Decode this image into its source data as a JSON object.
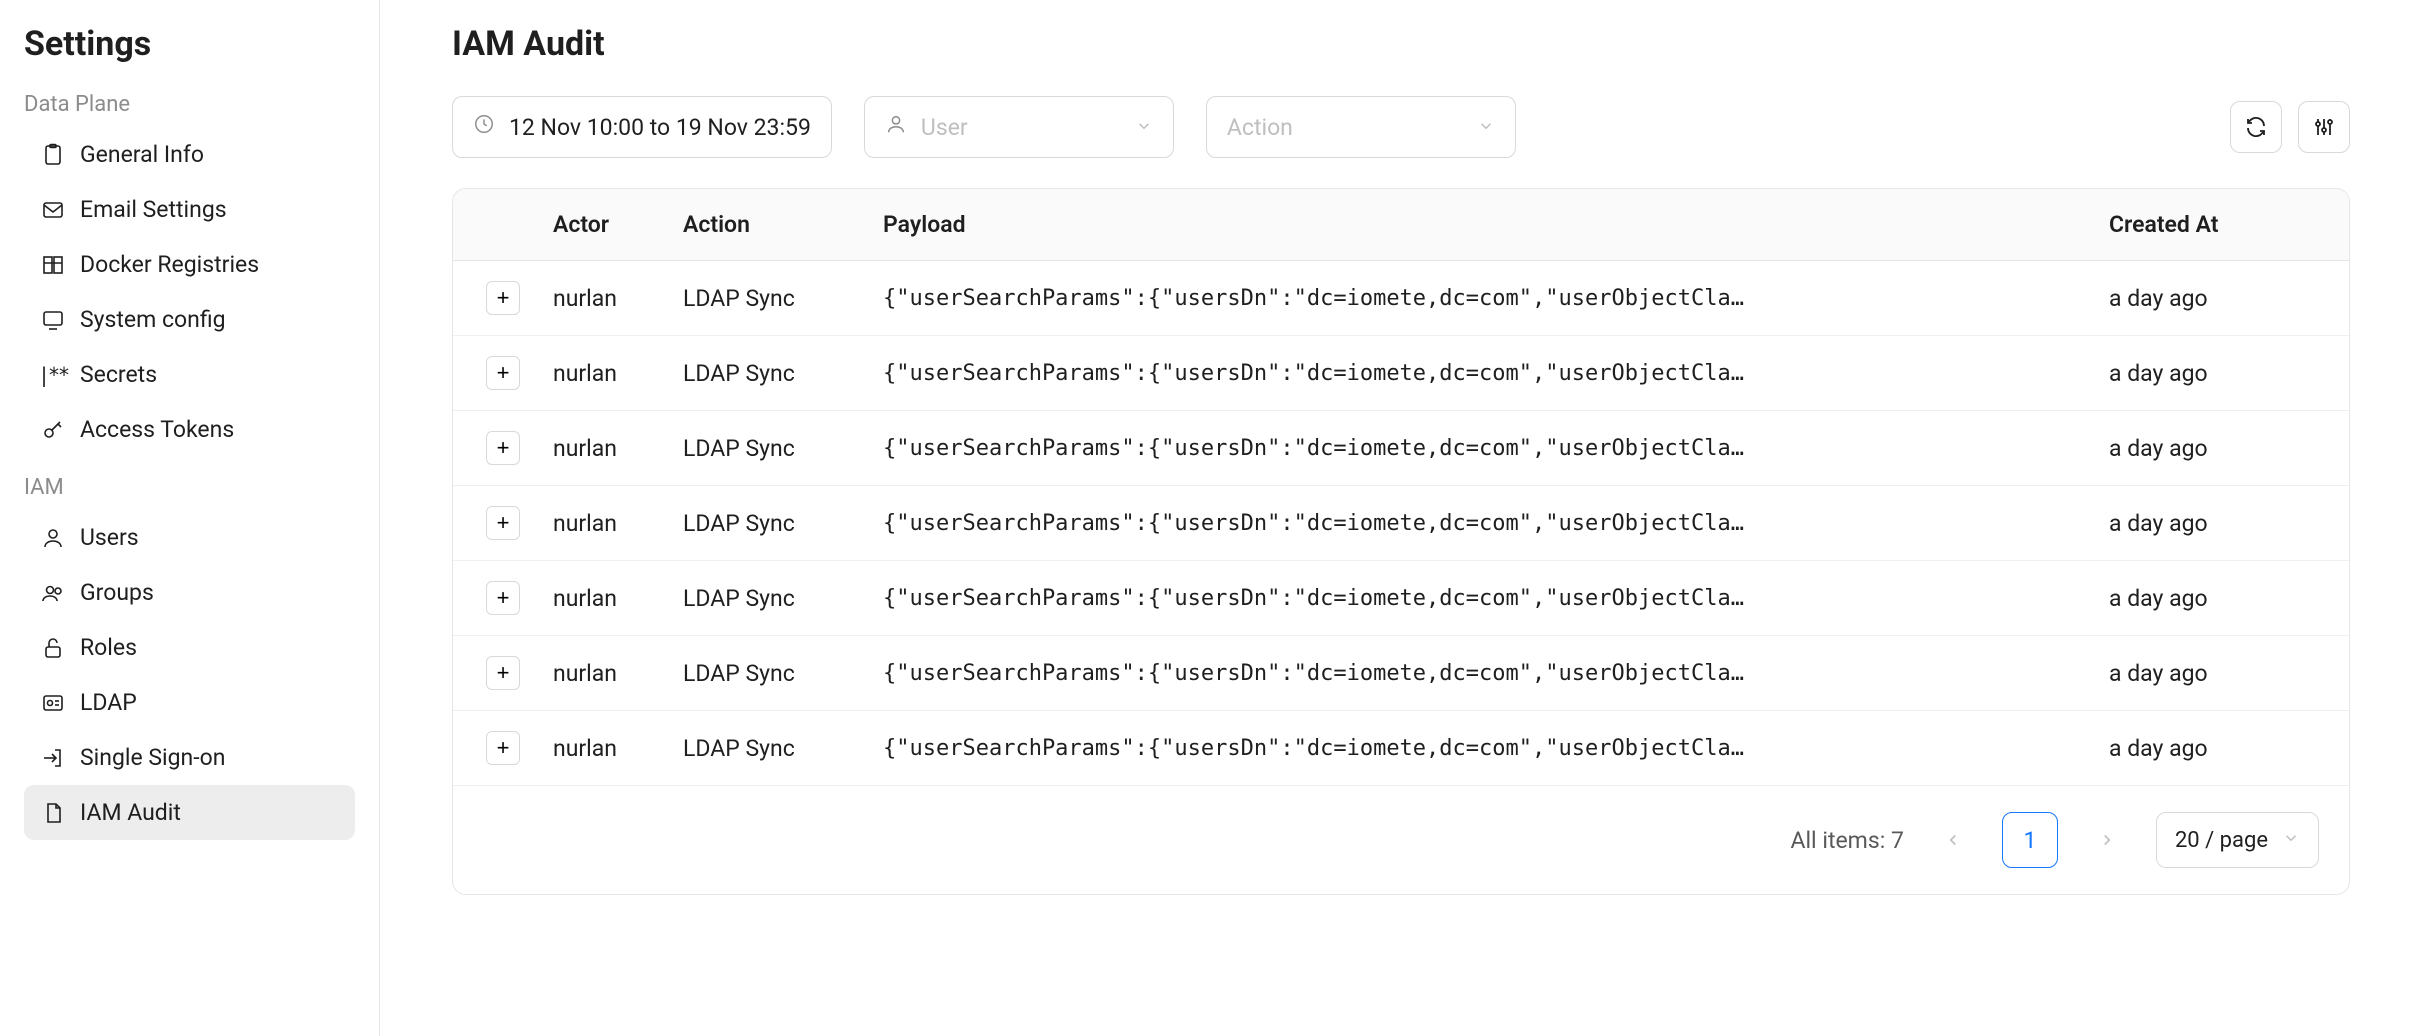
{
  "sidebar": {
    "title": "Settings",
    "sections": [
      {
        "label": "Data Plane",
        "items": [
          {
            "id": "general-info",
            "label": "General Info",
            "icon": "clipboard"
          },
          {
            "id": "email-settings",
            "label": "Email Settings",
            "icon": "mail"
          },
          {
            "id": "docker-registries",
            "label": "Docker Registries",
            "icon": "registry"
          },
          {
            "id": "system-config",
            "label": "System config",
            "icon": "monitor"
          },
          {
            "id": "secrets",
            "label": "Secrets",
            "icon": "secrets"
          },
          {
            "id": "access-tokens",
            "label": "Access Tokens",
            "icon": "key"
          }
        ]
      },
      {
        "label": "IAM",
        "items": [
          {
            "id": "users",
            "label": "Users",
            "icon": "user"
          },
          {
            "id": "groups",
            "label": "Groups",
            "icon": "users"
          },
          {
            "id": "roles",
            "label": "Roles",
            "icon": "lock"
          },
          {
            "id": "ldap",
            "label": "LDAP",
            "icon": "idcard"
          },
          {
            "id": "sso",
            "label": "Single Sign-on",
            "icon": "login"
          },
          {
            "id": "iam-audit",
            "label": "IAM Audit",
            "icon": "file",
            "active": true
          }
        ]
      }
    ]
  },
  "page": {
    "title": "IAM Audit"
  },
  "filters": {
    "date_range": "12 Nov 10:00 to 19 Nov 23:59",
    "user_placeholder": "User",
    "action_placeholder": "Action"
  },
  "table": {
    "columns": {
      "actor": "Actor",
      "action": "Action",
      "payload": "Payload",
      "created": "Created At"
    },
    "rows": [
      {
        "actor": "nurlan",
        "action": "LDAP Sync",
        "payload": "{\"userSearchParams\":{\"usersDn\":\"dc=iomete,dc=com\",\"userObjectCla…",
        "created": "a day ago"
      },
      {
        "actor": "nurlan",
        "action": "LDAP Sync",
        "payload": "{\"userSearchParams\":{\"usersDn\":\"dc=iomete,dc=com\",\"userObjectCla…",
        "created": "a day ago"
      },
      {
        "actor": "nurlan",
        "action": "LDAP Sync",
        "payload": "{\"userSearchParams\":{\"usersDn\":\"dc=iomete,dc=com\",\"userObjectCla…",
        "created": "a day ago"
      },
      {
        "actor": "nurlan",
        "action": "LDAP Sync",
        "payload": "{\"userSearchParams\":{\"usersDn\":\"dc=iomete,dc=com\",\"userObjectCla…",
        "created": "a day ago"
      },
      {
        "actor": "nurlan",
        "action": "LDAP Sync",
        "payload": "{\"userSearchParams\":{\"usersDn\":\"dc=iomete,dc=com\",\"userObjectCla…",
        "created": "a day ago"
      },
      {
        "actor": "nurlan",
        "action": "LDAP Sync",
        "payload": "{\"userSearchParams\":{\"usersDn\":\"dc=iomete,dc=com\",\"userObjectCla…",
        "created": "a day ago"
      },
      {
        "actor": "nurlan",
        "action": "LDAP Sync",
        "payload": "{\"userSearchParams\":{\"usersDn\":\"dc=iomete,dc=com\",\"userObjectCla…",
        "created": "a day ago"
      }
    ]
  },
  "footer": {
    "all_items_label": "All items:",
    "total": "7",
    "current_page": "1",
    "page_size_label": "20 / page"
  }
}
